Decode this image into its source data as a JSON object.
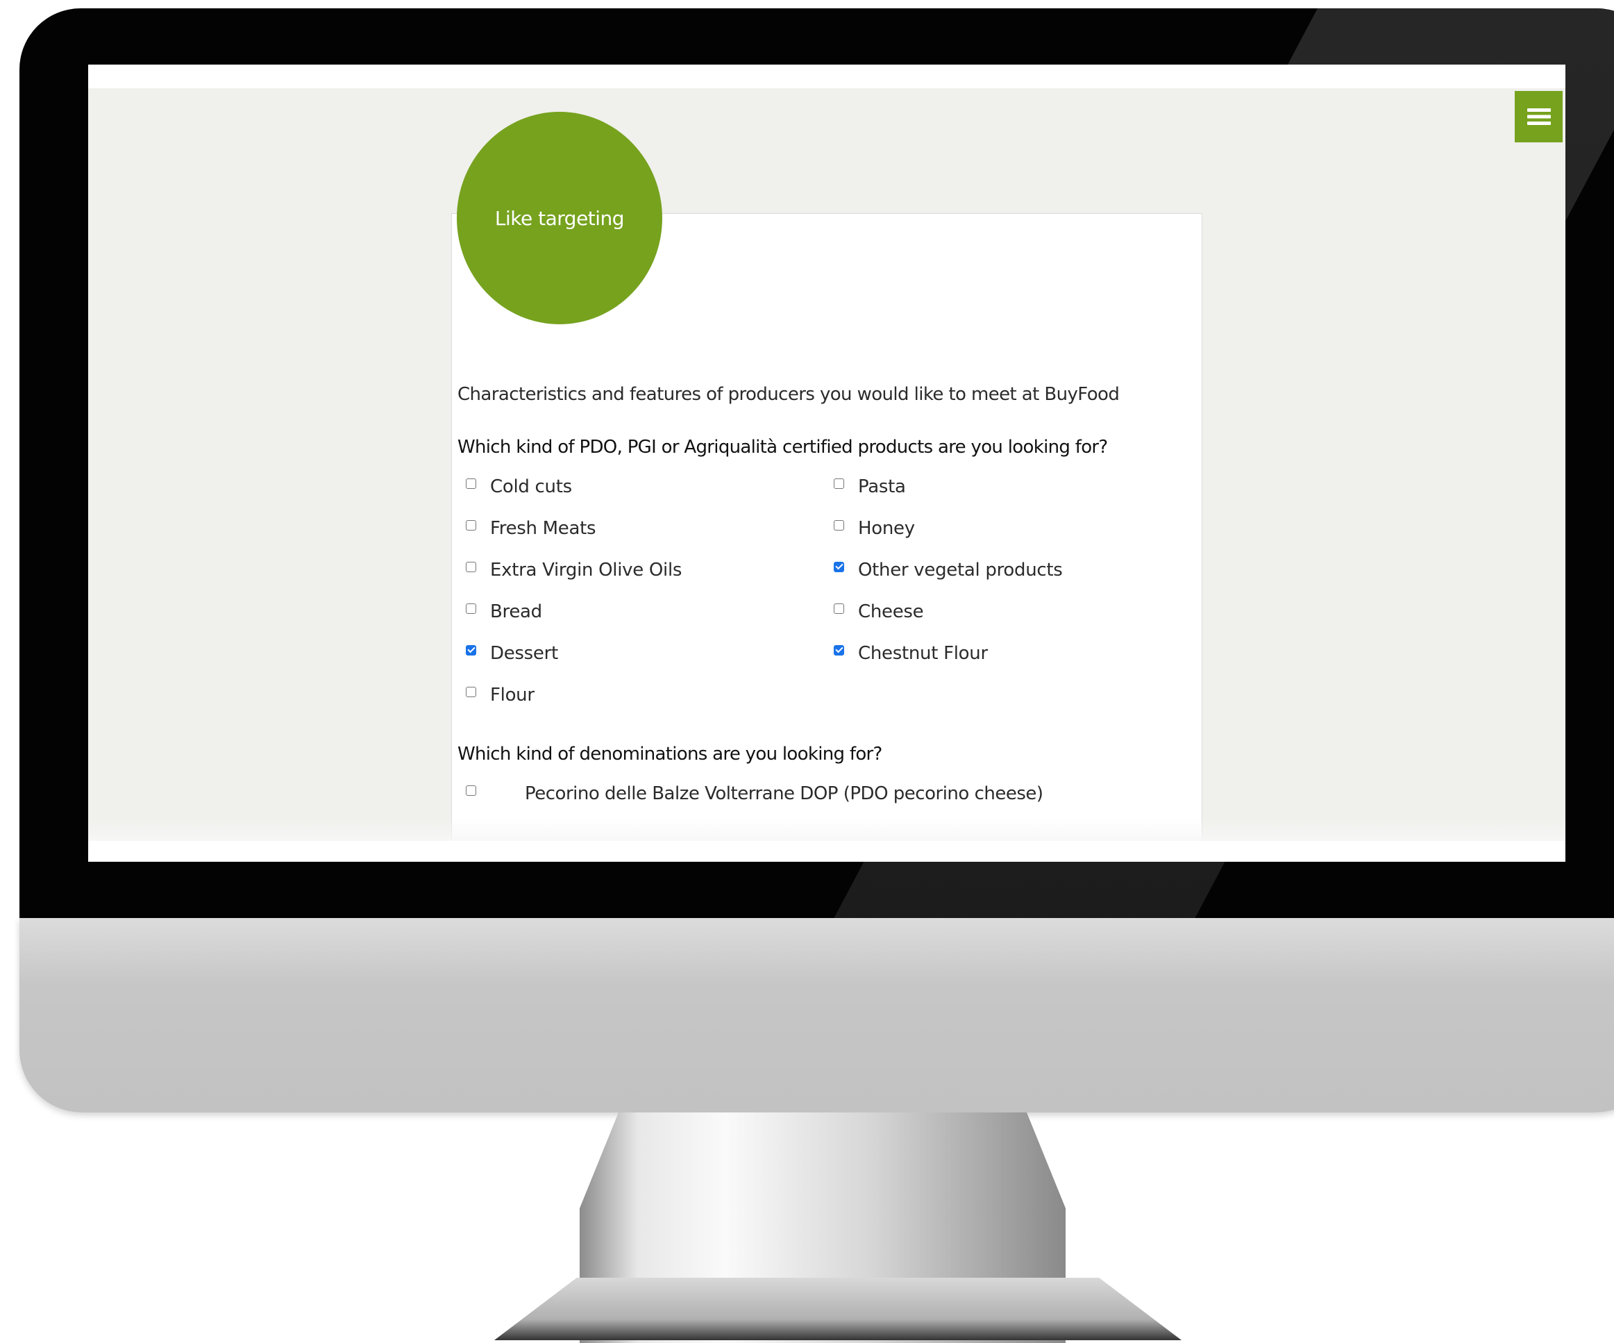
{
  "page": {
    "badge_label": "Like targeting",
    "menu_icon": "hamburger-menu-icon",
    "accent_color": "#76a21e"
  },
  "form": {
    "intro": "Characteristics and features of producers you would like to meet at BuyFood",
    "question_products": "Which kind of PDO, PGI or Agriqualità certified products are you looking for?",
    "products": [
      {
        "label": "Cold cuts",
        "checked": false
      },
      {
        "label": "Pasta",
        "checked": false
      },
      {
        "label": "Fresh Meats",
        "checked": false
      },
      {
        "label": "Honey",
        "checked": false
      },
      {
        "label": "Extra Virgin Olive Oils",
        "checked": false
      },
      {
        "label": "Other vegetal products",
        "checked": true
      },
      {
        "label": "Bread",
        "checked": false
      },
      {
        "label": "Cheese",
        "checked": false
      },
      {
        "label": "Dessert",
        "checked": true
      },
      {
        "label": "Chestnut Flour",
        "checked": true
      },
      {
        "label": "Flour",
        "checked": false
      }
    ],
    "question_denominations": "Which kind of denominations are you looking for?",
    "denominations": [
      {
        "label": "Pecorino delle Balze Volterrane DOP (PDO pecorino cheese)",
        "checked": false
      }
    ]
  }
}
